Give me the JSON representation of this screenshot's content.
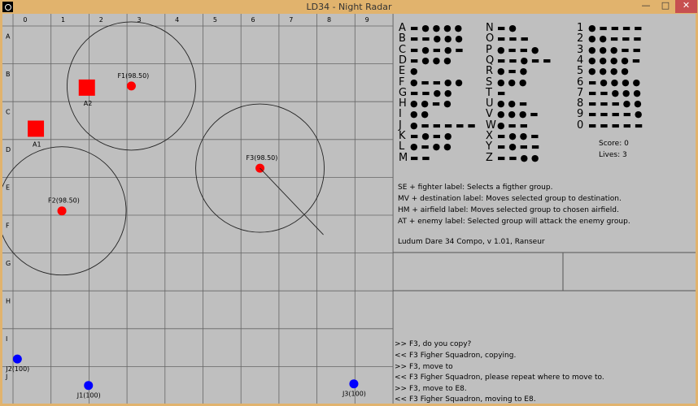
{
  "window": {
    "title": "LD34 - Night Radar",
    "min": "—",
    "max": "□",
    "close": "✕"
  },
  "grid": {
    "columns": [
      "0",
      "1",
      "2",
      "3",
      "4",
      "5",
      "6",
      "7",
      "8",
      "9"
    ],
    "rows": [
      "A",
      "B",
      "C",
      "D",
      "E",
      "F",
      "G",
      "H",
      "I",
      "J"
    ]
  },
  "units": [
    {
      "label": "F1(98.50)",
      "kind": "fighter",
      "cell": "B3",
      "color": "#ff0000"
    },
    {
      "label": "F2(98.50)",
      "kind": "fighter",
      "cell": "E1",
      "color": "#ff0000"
    },
    {
      "label": "F3(98.50)",
      "kind": "fighter",
      "cell": "D6",
      "color": "#ff0000"
    },
    {
      "label": "A2",
      "kind": "airfield",
      "cell": "B2",
      "color": "#ff0000"
    },
    {
      "label": "A1",
      "kind": "airfield",
      "cell": "C1",
      "color": "#ff0000"
    },
    {
      "label": "J2(100)",
      "kind": "enemy",
      "cell": "I0",
      "color": "#0000ff"
    },
    {
      "label": "J1(100)",
      "kind": "enemy",
      "cell": "J2",
      "color": "#0000ff"
    },
    {
      "label": "J3(100)",
      "kind": "enemy",
      "cell": "J8",
      "color": "#0000ff"
    }
  ],
  "morse": [
    {
      "k": "A",
      "s": "▬ ● ● ● ●"
    },
    {
      "k": "B",
      "s": "▬ ▬ ● ● ●"
    },
    {
      "k": "C",
      "s": "▬ ● ▬ ● ▬"
    },
    {
      "k": "D",
      "s": "▬ ● ● ●"
    },
    {
      "k": "E",
      "s": "●"
    },
    {
      "k": "F",
      "s": "● ▬ ▬ ● ●"
    },
    {
      "k": "G",
      "s": "▬ ▬ ● ●"
    },
    {
      "k": "H",
      "s": "● ● ▬ ●"
    },
    {
      "k": "I",
      "s": "● ●"
    },
    {
      "k": "J",
      "s": "● ▬ ▬ ▬ ▬ ▬"
    },
    {
      "k": "K",
      "s": "▬ ● ▬ ●"
    },
    {
      "k": "L",
      "s": "● ▬ ● ●"
    },
    {
      "k": "M",
      "s": "▬ ▬"
    },
    {
      "k": "N",
      "s": "▬ ●"
    },
    {
      "k": "O",
      "s": "▬ ▬ ▬"
    },
    {
      "k": "P",
      "s": "● ▬ ▬ ●"
    },
    {
      "k": "Q",
      "s": "▬ ▬ ● ▬ ▬"
    },
    {
      "k": "R",
      "s": "● ▬ ●"
    },
    {
      "k": "S",
      "s": "● ● ●"
    },
    {
      "k": "T",
      "s": "▬"
    },
    {
      "k": "U",
      "s": "● ● ▬"
    },
    {
      "k": "V",
      "s": "● ● ● ▬"
    },
    {
      "k": "W",
      "s": "● ▬ ▬"
    },
    {
      "k": "X",
      "s": "▬ ● ● ▬"
    },
    {
      "k": "Y",
      "s": "▬ ● ▬ ▬"
    },
    {
      "k": "Z",
      "s": "▬ ▬ ● ●"
    },
    {
      "k": "1",
      "s": "● ▬ ▬ ▬ ▬"
    },
    {
      "k": "2",
      "s": "● ● ▬ ▬ ▬"
    },
    {
      "k": "3",
      "s": "● ● ● ▬ ▬"
    },
    {
      "k": "4",
      "s": "● ● ● ● ▬"
    },
    {
      "k": "5",
      "s": "● ● ● ●"
    },
    {
      "k": "6",
      "s": "▬ ● ● ● ●"
    },
    {
      "k": "7",
      "s": "▬ ▬ ● ● ●"
    },
    {
      "k": "8",
      "s": "▬ ▬ ▬ ● ●"
    },
    {
      "k": "9",
      "s": "▬ ▬ ▬ ▬ ●"
    },
    {
      "k": "0",
      "s": "▬ ▬ ▬ ▬ ▬"
    }
  ],
  "score": "Score: 0",
  "lives": "Lives: 3",
  "help": [
    "SE + fighter label: Selects a figther group.",
    "MV + destination label: Moves selected group to destination.",
    "HM + airfield label: Moves selected group to chosen airfield.",
    "AT + enemy label: Selected group will attack the enemy group."
  ],
  "credits": "Ludum Dare 34 Compo, v 1.01, Ranseur",
  "log": [
    ">> F3, do you copy?",
    "<< F3 Figher Squadron, copying.",
    ">> F3, move to",
    "<< F3 Figher Squadron, please repeat where to move to.",
    ">> F3, move to E8.",
    "<< F3 Figher Squadron, moving to E8."
  ]
}
